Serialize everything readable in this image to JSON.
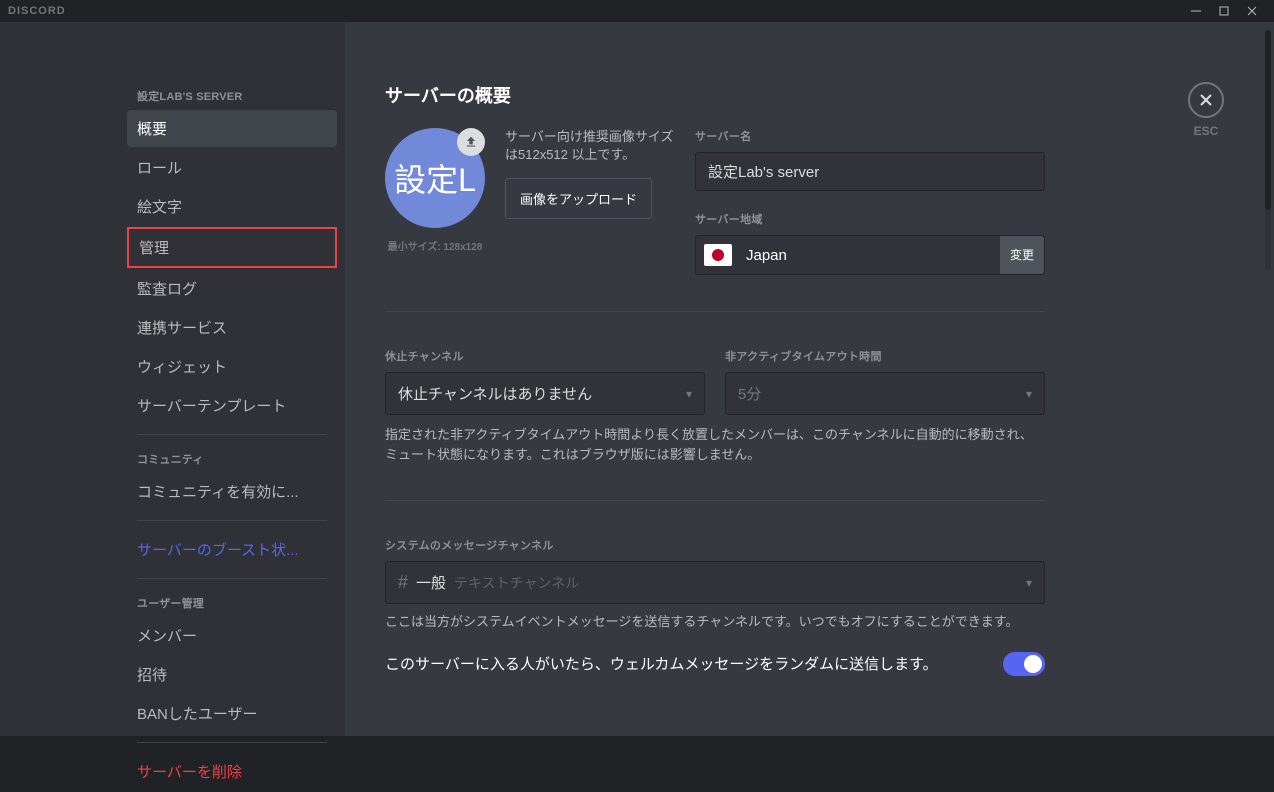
{
  "app": {
    "name": "DISCORD"
  },
  "close": {
    "label": "ESC"
  },
  "sidebar": {
    "header": "設定LAB'S SERVER",
    "items": [
      "概要",
      "ロール",
      "絵文字",
      "管理",
      "監査ログ",
      "連携サービス",
      "ウィジェット",
      "サーバーテンプレート"
    ],
    "community_header": "コミュニティ",
    "community_item": "コミュニティを有効に...",
    "boost": "サーバーのブースト状...",
    "user_mgmt_header": "ユーザー管理",
    "user_items": [
      "メンバー",
      "招待",
      "BANしたユーザー"
    ],
    "delete": "サーバーを削除"
  },
  "page": {
    "title": "サーバーの概要",
    "avatar_text": "設定L",
    "min_size": "最小サイズ: 128x128",
    "image_hint": "サーバー向け推奨画像サイズは512x512 以上です。",
    "upload_btn": "画像をアップロード",
    "name_label": "サーバー名",
    "name_value": "設定Lab's server",
    "region_label": "サーバー地域",
    "region_value": "Japan",
    "change_btn": "変更",
    "afk_channel_label": "休止チャンネル",
    "afk_channel_value": "休止チャンネルはありません",
    "afk_timeout_label": "非アクティブタイムアウト時間",
    "afk_timeout_value": "5分",
    "afk_help": "指定された非アクティブタイムアウト時間より長く放置したメンバーは、このチャンネルに自動的に移動され、ミュート状態になります。これはブラウザ版には影響しません。",
    "sys_label": "システムのメッセージチャンネル",
    "sys_channel": "一般",
    "sys_category": "テキストチャンネル",
    "sys_help": "ここは当方がシステムイベントメッセージを送信するチャンネルです。いつでもオフにすることができます。",
    "welcome_toggle": "このサーバーに入る人がいたら、ウェルカムメッセージをランダムに送信します。"
  }
}
